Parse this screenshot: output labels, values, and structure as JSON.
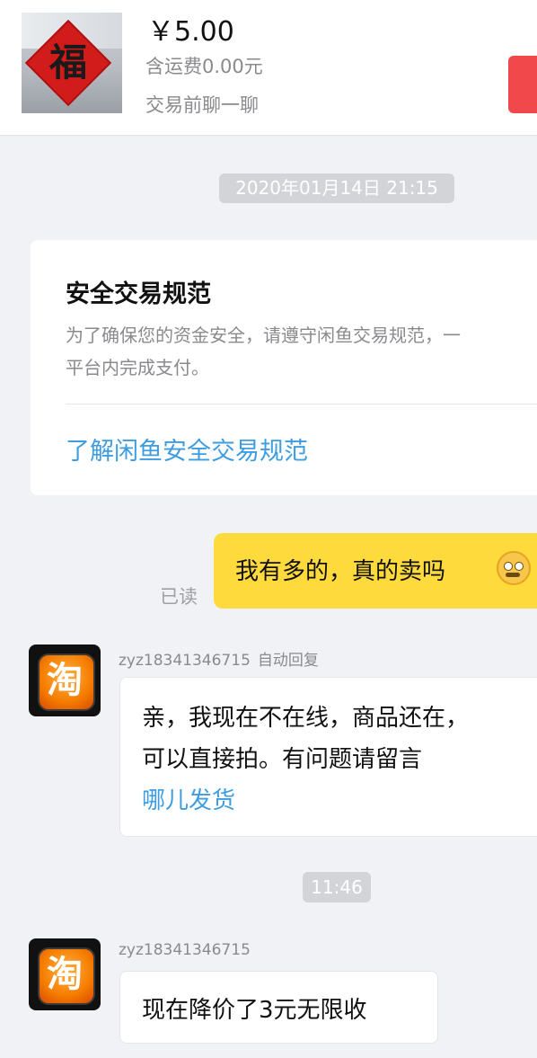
{
  "header": {
    "thumbnail": {
      "icon": "fu-diamond",
      "char": "福"
    },
    "price": "￥5.00",
    "shipping": "含运费0.00元",
    "chat_before": "交易前聊一聊"
  },
  "timestamps": [
    "2020年01月14日 21:15",
    "11:46"
  ],
  "safety_card": {
    "title": "安全交易规范",
    "body_line1": "为了确保您的资金安全，请遵守闲鱼交易规范，一",
    "body_line2": "平台内完成支付。",
    "link": "了解闲鱼安全交易规范"
  },
  "outgoing": {
    "text": "我有多的，真的卖吗",
    "emoji": "nervous-face-emoji",
    "read_status": "已读"
  },
  "incoming": [
    {
      "avatar_char": "淘",
      "sender": "zyz18341346715",
      "tag": "自动回复",
      "line1": "亲，我现在不在线，商品还在，",
      "line2": "可以直接拍。有问题请留言",
      "link": "哪儿发货"
    },
    {
      "avatar_char": "淘",
      "sender": "zyz18341346715",
      "line1": "现在降价了3元无限收"
    }
  ],
  "colors": {
    "background": "#f1f2f5",
    "outgoing_bubble": "#ffda3d",
    "link": "#3d9de0",
    "buy_button": "#f0484b"
  }
}
